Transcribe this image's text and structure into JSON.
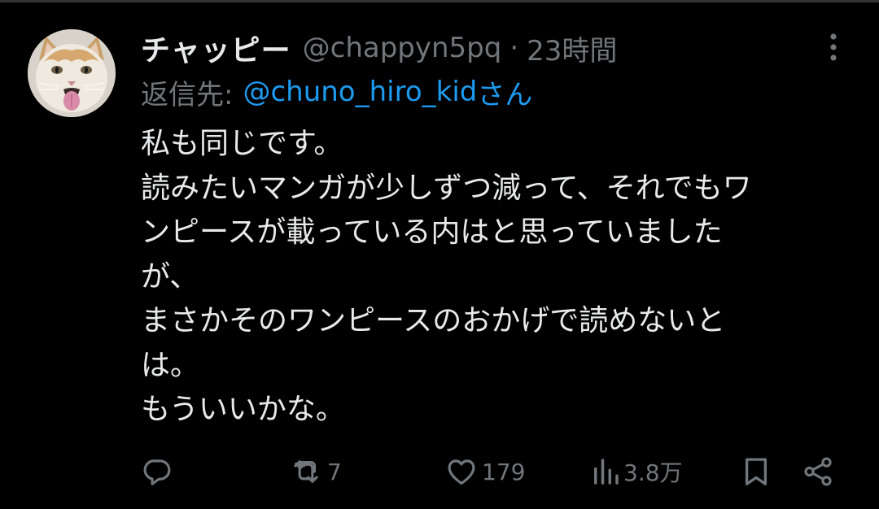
{
  "tweet": {
    "author": {
      "display_name": "チャッピー",
      "handle": "@chappyn5pq",
      "avatar": "cat-avatar"
    },
    "separator": "·",
    "timestamp": "23時間",
    "reply_to": {
      "label": "返信先:",
      "handle": "@chuno_hiro_kid",
      "suffix": "さん"
    },
    "body_lines": [
      "私も同じです。",
      "読みたいマンガが少しずつ減って、それでもワ",
      "ンピースが載っている内はと思っていました",
      "が、",
      "まさかそのワンピースのおかげで読めないと",
      "は。",
      "もういいかな。"
    ],
    "actions": {
      "reply": {
        "icon": "reply-icon"
      },
      "retweet": {
        "icon": "retweet-icon",
        "count": "7"
      },
      "like": {
        "icon": "heart-icon",
        "count": "179"
      },
      "views": {
        "icon": "views-icon",
        "count": "3.8万"
      },
      "bookmark": {
        "icon": "bookmark-icon"
      },
      "share": {
        "icon": "share-icon"
      }
    }
  },
  "colors": {
    "background": "#000000",
    "text_primary": "#e7e9ea",
    "text_secondary": "#71767b",
    "link": "#1d9bf0",
    "divider": "#2f3336"
  }
}
